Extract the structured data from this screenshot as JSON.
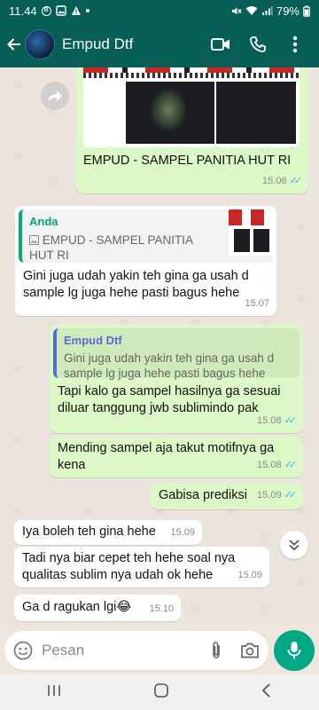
{
  "status_bar": {
    "time": "11.44",
    "battery": "79%"
  },
  "header": {
    "contact_name": "Empud Dtf"
  },
  "messages": [
    {
      "type": "image",
      "caption": "EMPUD - SAMPEL PANITIA HUT RI",
      "time": "15.06"
    },
    {
      "type": "reply",
      "quote_author": "Anda",
      "quote_text": "EMPUD - SAMPEL PANITIA HUT RI",
      "text": "Gini juga udah yakin teh gina ga usah d sample lg juga hehe pasti bagus hehe",
      "time": "15.07"
    },
    {
      "type": "reply",
      "quote_author": "Empud Dtf",
      "quote_text": "Gini juga udah yakin teh gina ga usah d sample lg juga hehe pasti bagus hehe",
      "text": "Tapi kalo ga sampel hasilnya ga sesuai diluar tanggung jwb sublimindo pak",
      "time": "15.08"
    },
    {
      "type": "text",
      "text": "Mending sampel aja takut motifnya ga kena",
      "time": "15.08"
    },
    {
      "type": "text",
      "text": "Gabisa prediksi",
      "time": "15.09"
    },
    {
      "type": "text",
      "text": "Iya boleh teh gina hehe",
      "time": "15.09"
    },
    {
      "type": "text",
      "text": "Tadi nya biar cepet teh hehe soal nya qualitas sublim nya udah ok hehe",
      "time": "15.09"
    },
    {
      "type": "text",
      "text": "Ga d ragukan lgi😂",
      "time": "15.10"
    }
  ],
  "input": {
    "placeholder": "Pesan"
  },
  "colors": {
    "header": "#075e54",
    "outgoing_bubble": "#dcf8c6",
    "incoming_bubble": "#ffffff",
    "quote_self": "#06a77d",
    "quote_contact": "#5b6bd6",
    "mic_button": "#00a884",
    "read_ticks": "#34b7f1"
  }
}
